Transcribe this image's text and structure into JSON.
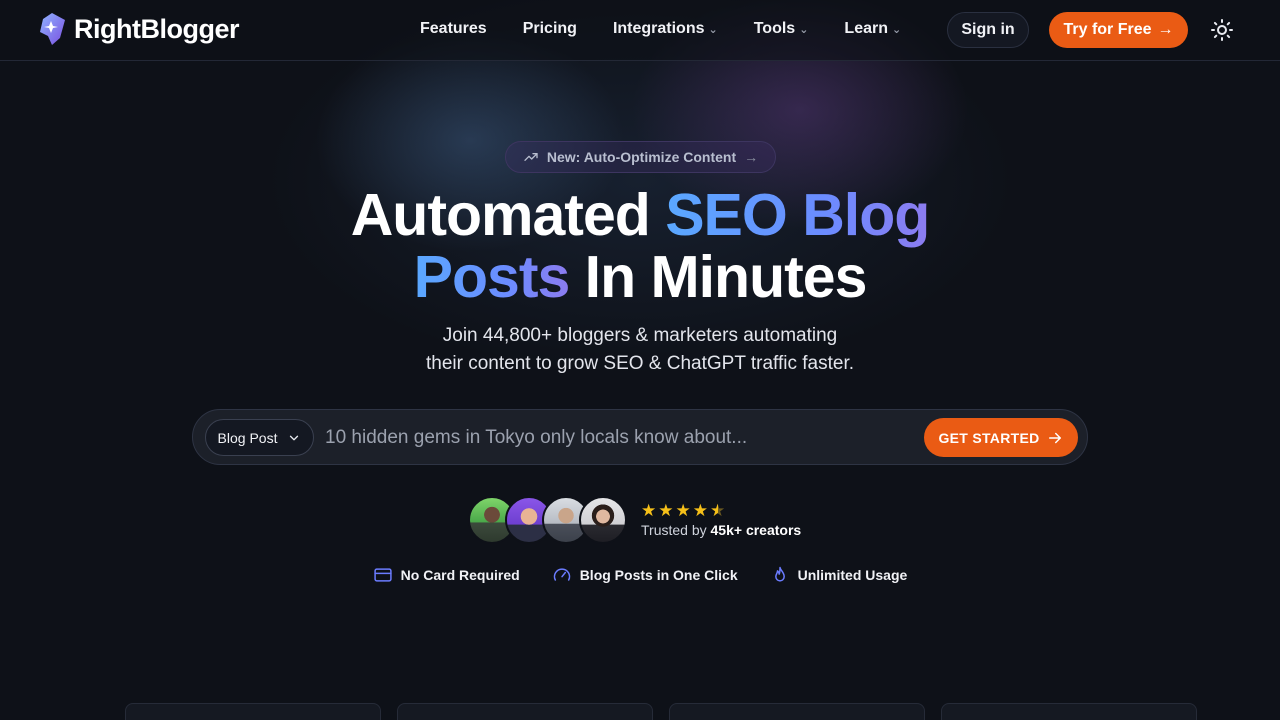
{
  "brand": {
    "name": "RightBlogger"
  },
  "nav": {
    "links": [
      {
        "label": "Features",
        "has_dropdown": false
      },
      {
        "label": "Pricing",
        "has_dropdown": false
      },
      {
        "label": "Integrations",
        "has_dropdown": true
      },
      {
        "label": "Tools",
        "has_dropdown": true
      },
      {
        "label": "Learn",
        "has_dropdown": true
      }
    ],
    "signin_label": "Sign in",
    "try_label": "Try for Free",
    "theme_icon": "sun-icon"
  },
  "hero": {
    "badge": "New: Auto-Optimize Content",
    "headline_part1": "Automated ",
    "headline_highlight1": "SEO Blog",
    "headline_highlight2": "Posts",
    "headline_part2": " In Minutes",
    "subhead_line1": "Join 44,800+ bloggers & marketers automating",
    "subhead_line2": "their content to grow SEO & ChatGPT traffic faster."
  },
  "search": {
    "type_value": "Blog Post",
    "placeholder": "10 hidden gems in Tokyo only locals know about...",
    "cta_label": "GET STARTED"
  },
  "social_proof": {
    "rating": 4.5,
    "trusted_prefix": "Trusted by ",
    "trusted_count": "45k+ creators"
  },
  "features": [
    {
      "icon": "credit-card-icon",
      "label": "No Card Required"
    },
    {
      "icon": "gauge-icon",
      "label": "Blog Posts in One Click"
    },
    {
      "icon": "flame-icon",
      "label": "Unlimited Usage"
    }
  ],
  "colors": {
    "accent": "#ea5b14",
    "background": "#0e1118",
    "highlight_start": "#5aa8ff",
    "highlight_end": "#8c7cf0",
    "icon_blue": "#6b7cff",
    "star": "#f6c019"
  }
}
